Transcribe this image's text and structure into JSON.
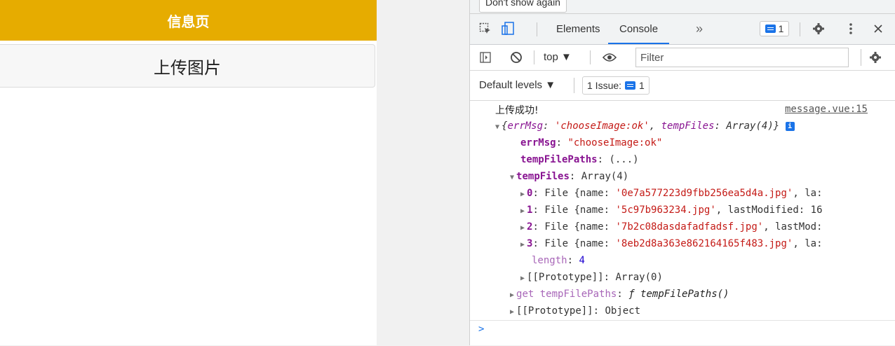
{
  "app": {
    "nav_title": "信息页",
    "upload_label": "上传图片"
  },
  "devtools": {
    "infobar": {
      "dont_show_label": "Don't show again"
    },
    "tabs": [
      {
        "label": "Elements"
      },
      {
        "label": "Console",
        "active": true
      }
    ],
    "more_tabs_glyph": "»",
    "message_count": "1",
    "filterbar": {
      "context": "top ▼",
      "filter_placeholder": "Filter"
    },
    "levelsbar": {
      "levels_label": "Default levels ▼",
      "issues_label": "1 Issue:",
      "issues_count": "1"
    },
    "console": {
      "log_text": "上传成功!",
      "source_link": "message.vue:15",
      "object_summary": {
        "open": "{",
        "key1": "errMsg",
        "val1": "'chooseImage:ok'",
        "key2": "tempFiles",
        "val2": "Array(4)",
        "close": "}"
      },
      "errmsg": {
        "key": "errMsg",
        "value": "\"chooseImage:ok\""
      },
      "tempfilepaths": {
        "key": "tempFilePaths",
        "value": "(...)"
      },
      "tempfiles": {
        "key": "tempFiles",
        "value": "Array(4)"
      },
      "files": [
        {
          "index": "0",
          "name": "'0e7a577223d9fbb256ea5d4a.jpg'",
          "rest": ", la:"
        },
        {
          "index": "1",
          "name": "'5c97b963234.jpg'",
          "rest": ", lastModified: 16"
        },
        {
          "index": "2",
          "name": "'7b2c08dasdafadfadsf.jpg'",
          "rest": ", lastMod:"
        },
        {
          "index": "3",
          "name": "'8eb2d8a363e862164165f483.jpg'",
          "rest": ", la:"
        }
      ],
      "length": {
        "key": "length",
        "value": "4"
      },
      "array_proto": {
        "key": "[[Prototype]]",
        "value": "Array(0)"
      },
      "getter": {
        "key": "get tempFilePaths",
        "value": "tempFilePaths()"
      },
      "object_proto": {
        "key": "[[Prototype]]",
        "value": "Object"
      },
      "prompt": ">"
    },
    "colors": {
      "accent": "#1a73e8",
      "nav_bg": "#e6ac00",
      "string": "#c41a16",
      "key": "#881391",
      "number": "#1c00cf"
    }
  }
}
